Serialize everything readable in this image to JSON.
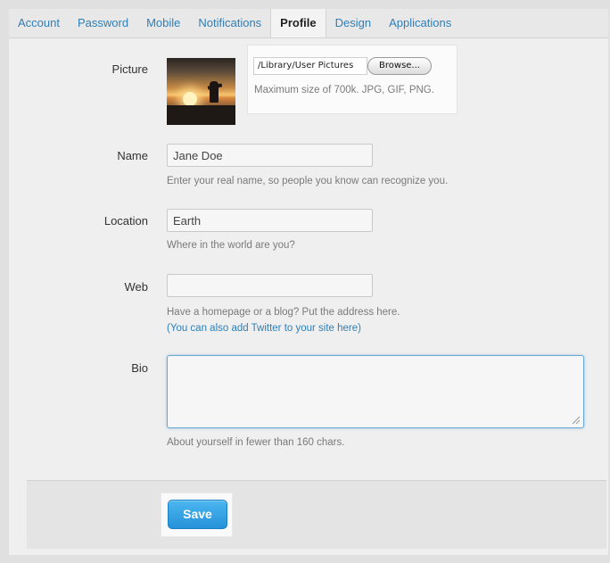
{
  "tabs": [
    {
      "label": "Account",
      "active": false
    },
    {
      "label": "Password",
      "active": false
    },
    {
      "label": "Mobile",
      "active": false
    },
    {
      "label": "Notifications",
      "active": false
    },
    {
      "label": "Profile",
      "active": true
    },
    {
      "label": "Design",
      "active": false
    },
    {
      "label": "Applications",
      "active": false
    }
  ],
  "picture": {
    "label": "Picture",
    "file_path": "/Library/User Pictures",
    "browse_label": "Browse...",
    "help": "Maximum size of 700k. JPG, GIF, PNG."
  },
  "name": {
    "label": "Name",
    "value": "Jane Doe",
    "help": "Enter your real name, so people you know can recognize you."
  },
  "location": {
    "label": "Location",
    "value": "Earth",
    "help": "Where in the world are you?"
  },
  "web": {
    "label": "Web",
    "value": "",
    "help": "Have a homepage or a blog? Put the address here.",
    "link": "(You can also add Twitter to your site here)"
  },
  "bio": {
    "label": "Bio",
    "value": "",
    "help": "About yourself in fewer than 160 chars."
  },
  "save_label": "Save",
  "colors": {
    "link": "#2f7fb6",
    "save_button": "#2592d9",
    "focus_border": "#66a8d6"
  }
}
